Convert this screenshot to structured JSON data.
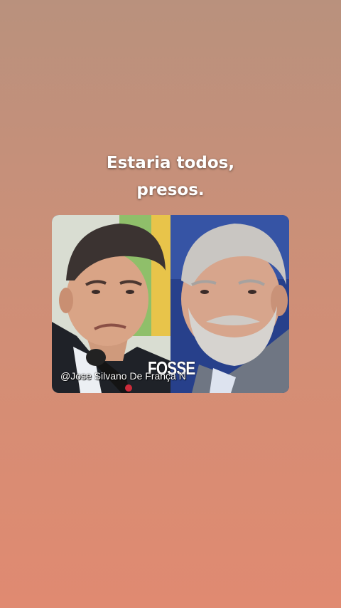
{
  "caption": {
    "line1": "Estaria todos,",
    "line2": "presos."
  },
  "photo": {
    "overlay_word": "FOSSE",
    "watermark": "@Jose Silvano De França N"
  },
  "colors": {
    "background_top": "#b9917d",
    "background_bottom": "#e08a71",
    "caption_text": "#ffffff"
  }
}
